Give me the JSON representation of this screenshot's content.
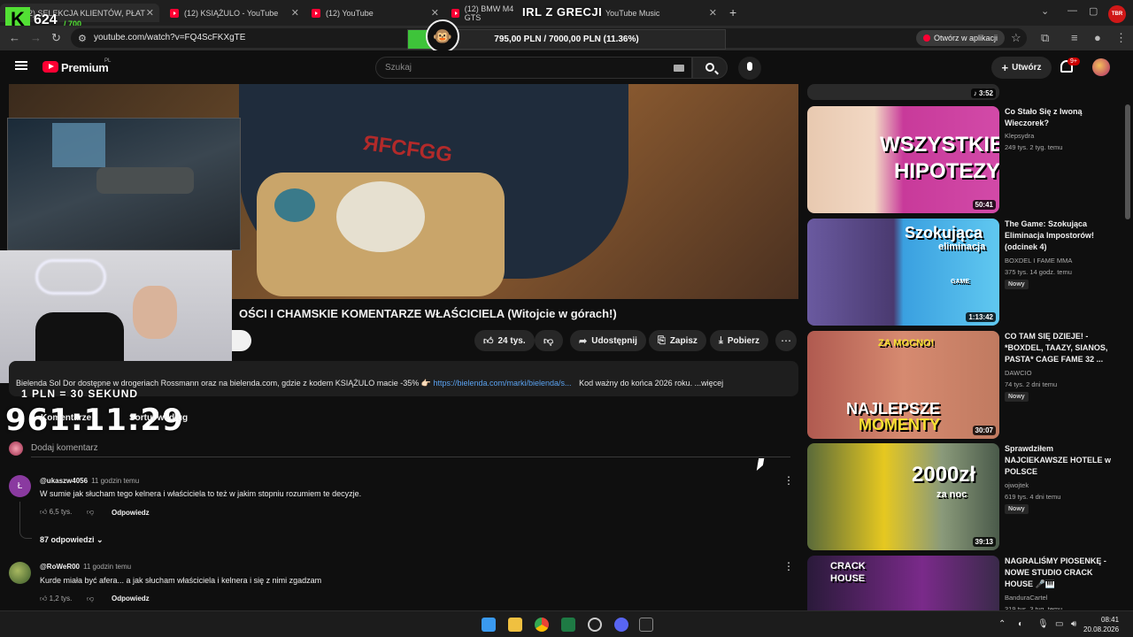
{
  "browser": {
    "tabs": [
      {
        "label": "(12) SELEKCJA KLIENTÓW, PŁAT"
      },
      {
        "label": "(12) KSIĄŻULO - YouTube"
      },
      {
        "label": "(12) YouTube"
      },
      {
        "label": "(12) BMW M4 GTS"
      },
      {
        "label": "YouTube Music"
      }
    ],
    "url": "youtube.com/watch?v=FQ4ScFKXgTE",
    "open_in_app": "Otwórz w aplikacji"
  },
  "stream_overlay": {
    "title": "IRL Z GRECJI",
    "goal_text": "795,00 PLN / 7000,00 PLN (11.36%)",
    "goal_progress_percent": 11.36,
    "viewers": "624",
    "viewers_goal": "/ 700",
    "kick_letter": "K",
    "rate_text": "1 PLN = 30 SEKUND",
    "timer": "961:11:29",
    "badge_text": "TBR"
  },
  "masthead": {
    "brand": "Premium",
    "region": "PL",
    "search_placeholder": "Szukaj",
    "create_label": "Utwórz",
    "notifications_badge": "9+"
  },
  "video": {
    "hoodie_text": "ЯFCFGG",
    "title": "OŚCI I CHAMSKIE KOMENTARZE WŁAŚCICIELA (Witojcie w górach!)",
    "likes": "24 tys.",
    "share_label": "Udostępnij",
    "save_label": "Zapisz",
    "download_label": "Pobierz",
    "description_text": "Bielenda Sol Dor dostępne w drogeriach Rossmann oraz na bielenda.com, gdzie z kodem KSIĄŻULO macie -35% 👉🏻",
    "description_link": "https://bielenda.com/marki/bielenda/s...",
    "description_tail": "Kod ważny do końca 2026 roku. ...więcej"
  },
  "comments": {
    "header": "Komentarze",
    "sort_label": "Sortuj według",
    "add_placeholder": "Dodaj komentarz",
    "reply_label": "Odpowiedz",
    "items": [
      {
        "avatar": "Ł",
        "author": "@ukaszw4056",
        "time": "11 godzin temu",
        "text": "W sumie jak słucham tego kelnera i właściciela to też w jakim stopniu rozumiem te decyzje.",
        "likes": "6,5 tys.",
        "replies": "87 odpowiedzi"
      },
      {
        "avatar": "",
        "author": "@RoWeR00",
        "time": "11 godzin temu",
        "text": "Kurde miała być afera... a jak słucham właściciela i kelnera i się z nimi zgadzam",
        "likes": "1,2 tys."
      }
    ]
  },
  "sidebar": {
    "top_duration": "3:52",
    "items": [
      {
        "title": "Co Stało Się z Iwoną Wieczorek?",
        "channel": "Klepsydra",
        "meta": "249 tys.   2 tyg. temu",
        "duration": "50:41",
        "thumb_text": [
          "WSZYSTKIE",
          "HIPOTEZY"
        ]
      },
      {
        "title": "The Game: Szokująca Eliminacja Impostorów! (odcinek 4)",
        "channel": "BOXDEL   I FAME MMA",
        "meta": "375 tys.   14 godz. temu",
        "badge": "Nowy",
        "duration": "1:13:42",
        "thumb_text": [
          "Szokująca",
          "eliminacja",
          "GAME"
        ]
      },
      {
        "title": "CO TAM SIĘ DZIEJE! - *BOXDEL, TAAZY, SIANOS, PASTA* CAGE FAME 32 ...",
        "channel": "DAWCIO",
        "meta": "74 tys.   2 dni temu",
        "badge": "Nowy",
        "duration": "30:07",
        "thumb_text": [
          "ZA MOCNO!",
          "NAJLEPSZE",
          "MOMENTY"
        ]
      },
      {
        "title": "Sprawdziłem NAJCIEKAWSZE HOTELE w POLSCE",
        "channel": "ojwojtek",
        "meta": "619 tys.   4 dni temu",
        "badge": "Nowy",
        "duration": "39:13",
        "thumb_text": [
          "2000zł",
          "za noc"
        ]
      },
      {
        "title": "NAGRALIŚMY PIOSENKĘ - NOWE STUDIO CRACK HOUSE 🎤🎹",
        "channel": "BanduraCartel",
        "meta": "319 tys.   3 tyg. temu",
        "thumb_text": [
          "CRACK",
          "HOUSE"
        ]
      }
    ]
  },
  "taskbar": {
    "time": "08:41",
    "date": "20.08.2026"
  },
  "colors": {
    "yt_red": "#ff0033",
    "kick_green": "#52e034",
    "link_blue": "#5aa2f0"
  }
}
